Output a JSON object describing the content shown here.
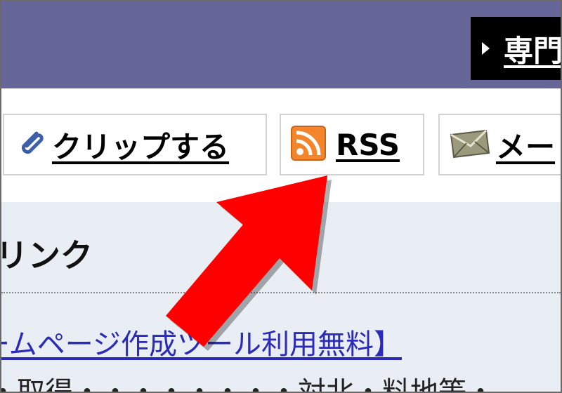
{
  "header": {
    "expert_link_label": "専門"
  },
  "toolbar": {
    "clip_label": "クリップする",
    "rss_label": "RSS",
    "mail_label": "メー"
  },
  "panel": {
    "title": "リンク",
    "link_text": "ームページ作成ツール利用無料】",
    "next_text": "・取得・・・・・・・・対北・料地等・"
  },
  "colors": {
    "header_bg": "#666699",
    "rss_orange": "#f5852a",
    "arrow_red": "#ff0000",
    "panel_bg": "#e8eef4",
    "link_blue": "#2b2bb8"
  },
  "icons": {
    "expert": "triangle-right-icon",
    "clip": "paperclip-icon",
    "rss": "rss-feed-icon",
    "mail": "envelope-icon"
  }
}
